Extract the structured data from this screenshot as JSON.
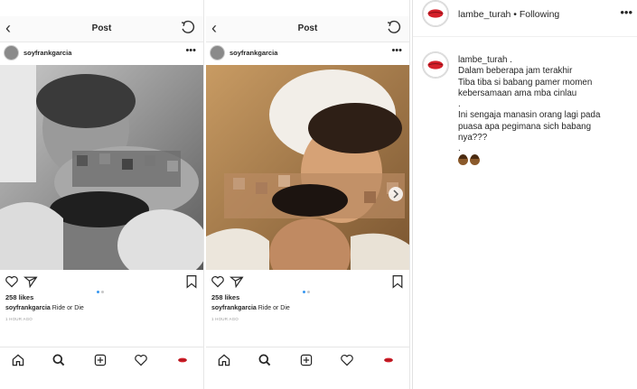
{
  "panels": [
    {
      "title": "Post",
      "username": "soyfrankgarcia",
      "likes": "258 likes",
      "caption_user": "soyfrankgarcia",
      "caption_text": "Ride or Die",
      "time": "1 HOUR AGO"
    },
    {
      "title": "Post",
      "username": "soyfrankgarcia",
      "likes": "258 likes",
      "caption_user": "soyfrankgarcia",
      "caption_text": "Ride or Die",
      "time": "1 HOUR AGO"
    }
  ],
  "sidebar": {
    "account": "lambe_turah",
    "separator": " • ",
    "following": "Following",
    "comment_user": "lambe_turah .",
    "comment_lines": [
      "Dalam beberapa jam terakhir",
      "Tiba tiba si babang pamer momen",
      "kebersamaan ama mba cinlau",
      ".",
      "",
      "Ini sengaja manasin orang lagi pada",
      "puasa apa pegimana sich babang",
      "nya???",
      "."
    ]
  },
  "colors": {
    "active_dot": "#3897f0",
    "inactive_dot": "#c7c7c7",
    "lips_red": "#d4202a",
    "border": "#e6e6e6"
  },
  "icons": [
    "back-arrow-icon",
    "refresh-icon",
    "more-dots-icon",
    "heart-icon",
    "send-icon",
    "bookmark-icon",
    "home-icon",
    "search-icon",
    "add-post-icon",
    "activity-heart-icon",
    "profile-lips-icon",
    "next-arrow-icon",
    "woman-emoji-icon"
  ]
}
